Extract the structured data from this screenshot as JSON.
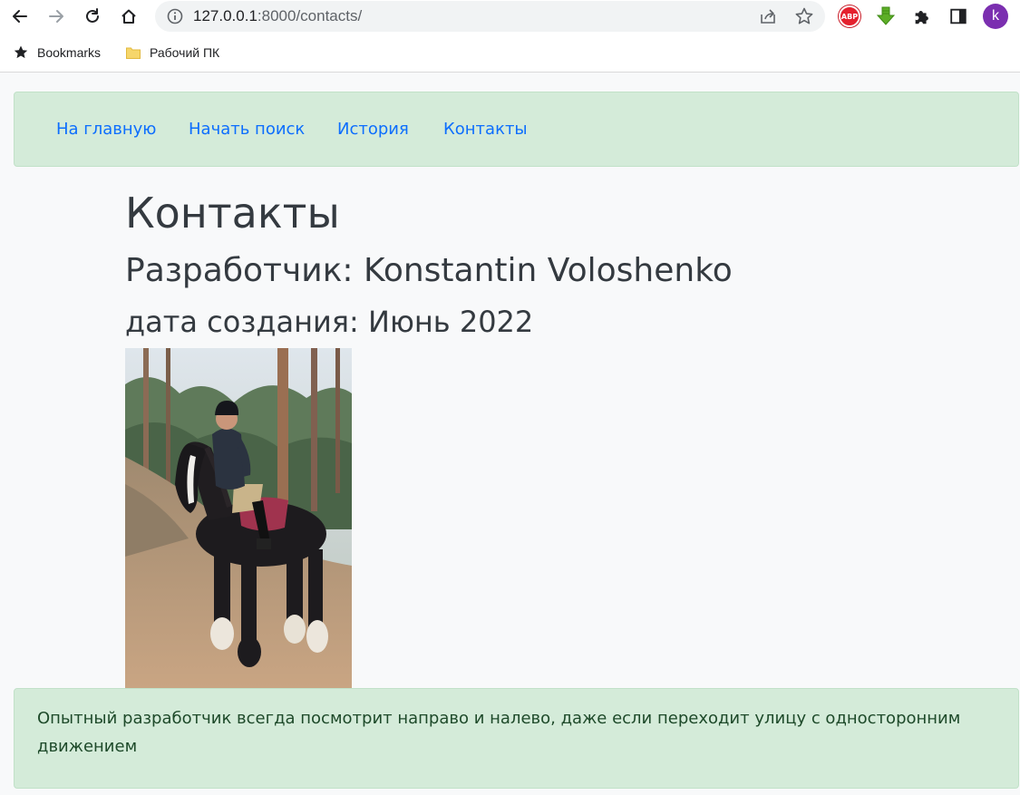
{
  "browser": {
    "url_host": "127.0.0.1",
    "url_rest": ":8000/contacts/",
    "profile_initial": "k",
    "extensions": [
      "abp-icon",
      "download-arrow-icon",
      "puzzle-icon",
      "side-panel-icon"
    ],
    "bookmarks": [
      {
        "label": "Bookmarks",
        "icon": "star-icon"
      },
      {
        "label": "Рабочий ПК",
        "icon": "folder-icon"
      }
    ],
    "abp_label": "ABP"
  },
  "nav": {
    "items": [
      {
        "label": "На главную"
      },
      {
        "label": "Начать поиск"
      },
      {
        "label": "История"
      },
      {
        "label": "Контакты"
      }
    ]
  },
  "main": {
    "title": "Контакты",
    "developer": "Разработчик: Konstantin Voloshenko",
    "created": "дата создания: Июнь 2022"
  },
  "footer": {
    "text": "Опытный разработчик всегда посмотрит направо и налево, даже если переходит улицу с односторонним движением"
  },
  "colors": {
    "nav_bg": "#d4ebd9",
    "link": "#0d6efd",
    "heading": "#343a40",
    "avatar": "#7b2fb0"
  }
}
